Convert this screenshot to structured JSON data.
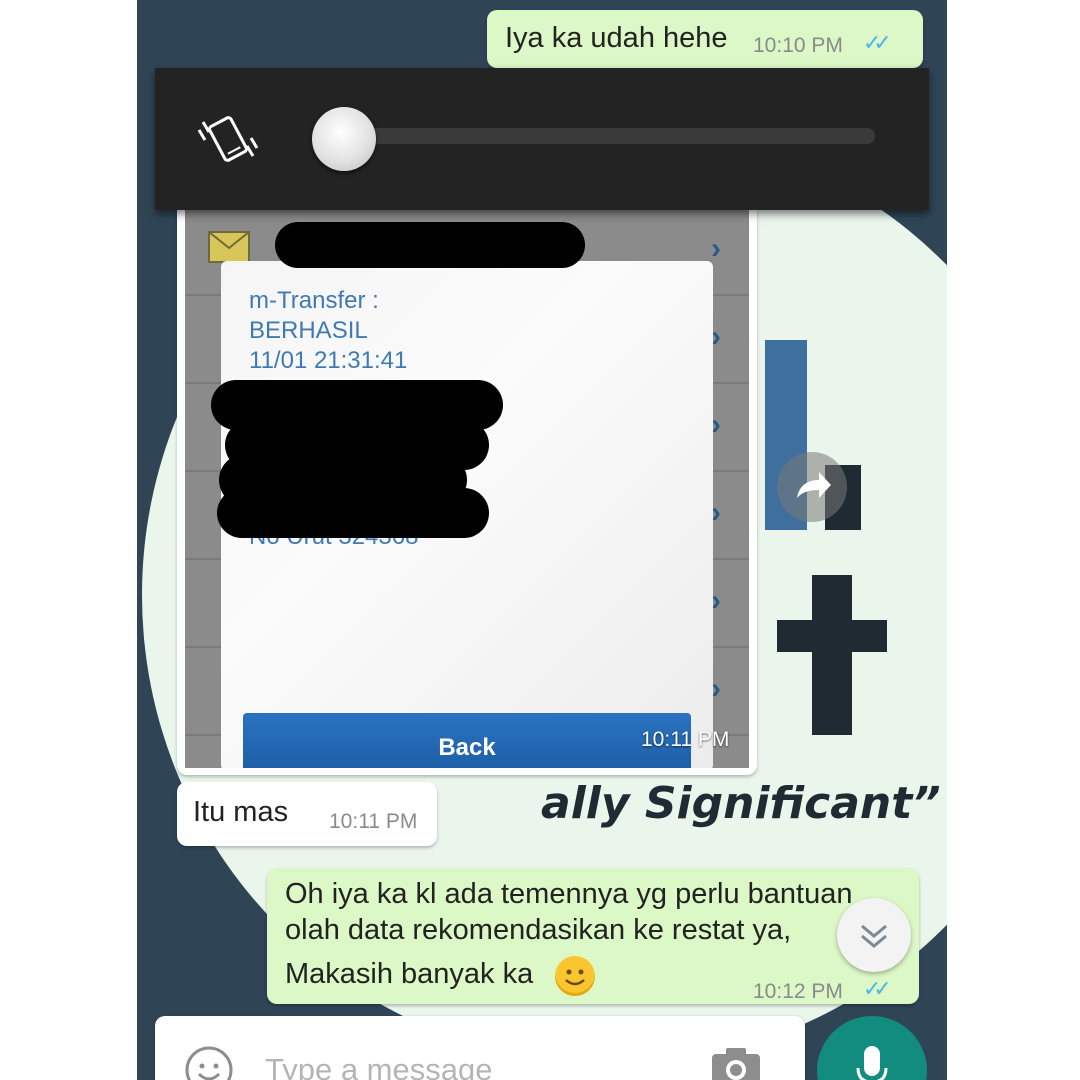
{
  "messages": {
    "m1": {
      "text": "Iya ka udah hehe",
      "time": "10:10 PM",
      "ticks": "✓✓"
    },
    "image_time": "10:11 PM",
    "m2": {
      "text": "Itu mas",
      "time": "10:11 PM"
    },
    "m3": {
      "lines": [
        "Oh iya ka kl ada temennya yg perlu bantuan",
        "olah data rekomendasikan ke restat ya,",
        "Makasih banyak ka"
      ],
      "emoji": "😊",
      "time": "10:12 PM",
      "ticks": "✓✓"
    }
  },
  "screenshot": {
    "lines": [
      "m-Transfer :",
      "BERHASIL",
      "11/01 21:31:41",
      "No Urut 324368"
    ],
    "back_label": "Back"
  },
  "wallpaper": {
    "slogan": "ally Significant”",
    "letters": "t"
  },
  "volume": {
    "level": 0.0,
    "mode": "vibrate"
  },
  "input": {
    "placeholder": "Type a message"
  },
  "colors": {
    "outgoing_bubble": "#dcf8c6",
    "incoming_bubble": "#ffffff",
    "read_ticks": "#4fb3f0",
    "mic_button": "#128c7e"
  }
}
